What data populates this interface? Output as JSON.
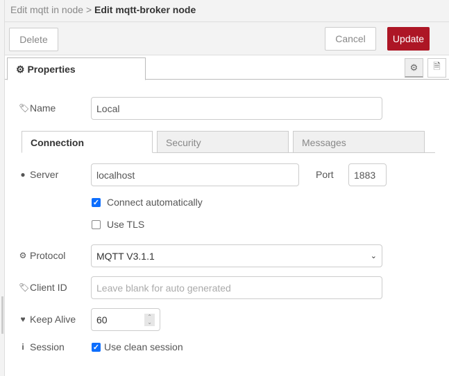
{
  "header": {
    "breadcrumb_parent": "Edit mqtt in node",
    "separator": ">",
    "title": "Edit mqtt-broker node"
  },
  "toolbar": {
    "delete": "Delete",
    "cancel": "Cancel",
    "update": "Update"
  },
  "tabs": {
    "properties": "Properties"
  },
  "form": {
    "name": {
      "label": "Name",
      "value": "Local"
    },
    "subtabs": [
      "Connection",
      "Security",
      "Messages"
    ],
    "server": {
      "label": "Server",
      "value": "localhost"
    },
    "port": {
      "label": "Port",
      "value": "1883"
    },
    "connect_auto": {
      "label": "Connect automatically",
      "checked": true
    },
    "use_tls": {
      "label": "Use TLS",
      "checked": false
    },
    "protocol": {
      "label": "Protocol",
      "value": "MQTT V3.1.1"
    },
    "client_id": {
      "label": "Client ID",
      "placeholder": "Leave blank for auto generated"
    },
    "keep_alive": {
      "label": "Keep Alive",
      "value": "60"
    },
    "session": {
      "label": "Session",
      "checkbox_label": "Use clean session",
      "checked": true
    }
  },
  "colors": {
    "accent": "#ad1625",
    "checkbox": "#0d6efd"
  }
}
